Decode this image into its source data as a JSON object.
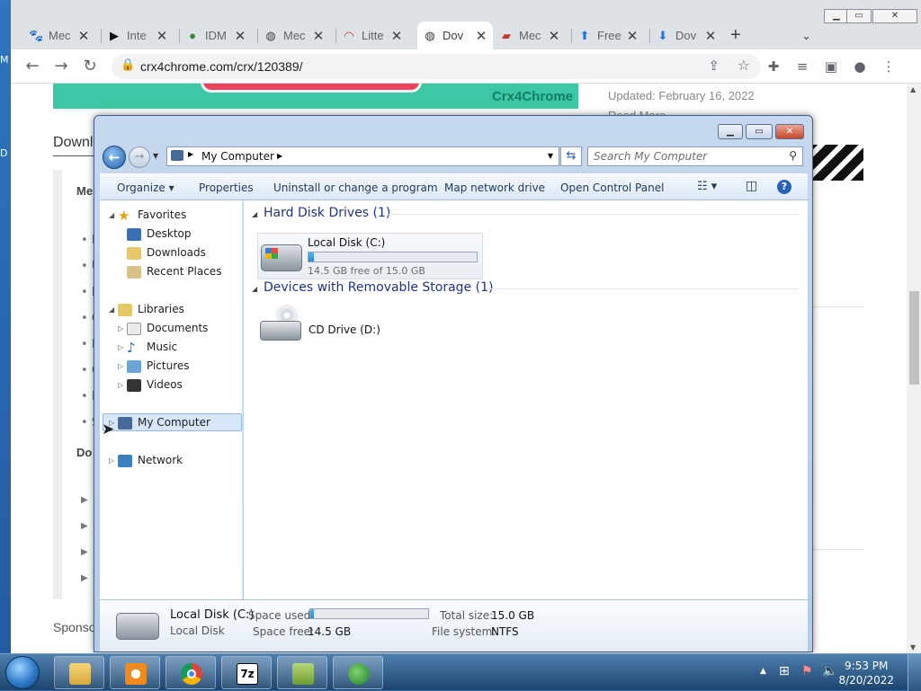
{
  "desktop": {
    "icon_labels": [
      "M",
      "D"
    ]
  },
  "browser": {
    "tabs": [
      {
        "title": "Mec",
        "icon": "paw-icon",
        "active": false
      },
      {
        "title": "Inte",
        "icon": "play-icon",
        "active": false
      },
      {
        "title": "IDM",
        "icon": "globe-icon",
        "active": false
      },
      {
        "title": "Mec",
        "icon": "globe-icon",
        "active": false
      },
      {
        "title": "Litte",
        "icon": "shield-icon",
        "active": false
      },
      {
        "title": "Dov",
        "icon": "globe-icon",
        "active": true
      },
      {
        "title": "Mec",
        "icon": "car-icon",
        "active": false
      },
      {
        "title": "Free",
        "icon": "arrow-up-icon",
        "active": false
      },
      {
        "title": "Dov",
        "icon": "download-icon",
        "active": false
      }
    ],
    "new_tab": "+",
    "url": "crx4chrome.com/crx/120389/",
    "page": {
      "banner_logo": "Crx4Chrome",
      "updated": "Updated: February 16, 2022",
      "read_more": "Read More",
      "download_heading": "Downl",
      "menu_heading": "Me",
      "bullets": [
        "P",
        "U",
        "E",
        "C",
        "F",
        "C",
        "M",
        "S"
      ],
      "download_sub": "Do",
      "arrows": [
        "▶",
        "▶",
        "▶",
        "▶"
      ],
      "sponsor": "Sponso"
    }
  },
  "explorer": {
    "breadcrumb": "My Computer",
    "search_placeholder": "Search My Computer",
    "commands": [
      "Organize",
      "Properties",
      "Uninstall or change a program",
      "Map network drive",
      "Open Control Panel"
    ],
    "nav": {
      "favorites": "Favorites",
      "favorites_items": [
        "Desktop",
        "Downloads",
        "Recent Places"
      ],
      "libraries": "Libraries",
      "libraries_items": [
        "Documents",
        "Music",
        "Pictures",
        "Videos"
      ],
      "computer": "My Computer",
      "network": "Network"
    },
    "groups": [
      {
        "title": "Hard Disk Drives (1)"
      },
      {
        "title": "Devices with Removable Storage (1)"
      }
    ],
    "drive_c": {
      "name": "Local Disk (C:)",
      "free_text": "14.5 GB free of 15.0 GB",
      "used_fraction": 0.03
    },
    "drive_d": {
      "name": "CD Drive (D:)"
    },
    "details": {
      "name": "Local Disk (C:)",
      "type": "Local Disk",
      "space_used_label": "Space used:",
      "space_free_label": "Space free:",
      "space_free": "14.5 GB",
      "total_label": "Total size:",
      "total": "15.0 GB",
      "fs_label": "File system:",
      "fs": "NTFS"
    }
  },
  "taskbar": {
    "apps": [
      "explorer-icon",
      "media-player-icon",
      "chrome-icon",
      "7zip-icon",
      "archive-icon",
      "idm-icon"
    ],
    "time": "9:53 PM",
    "date": "8/20/2022"
  }
}
